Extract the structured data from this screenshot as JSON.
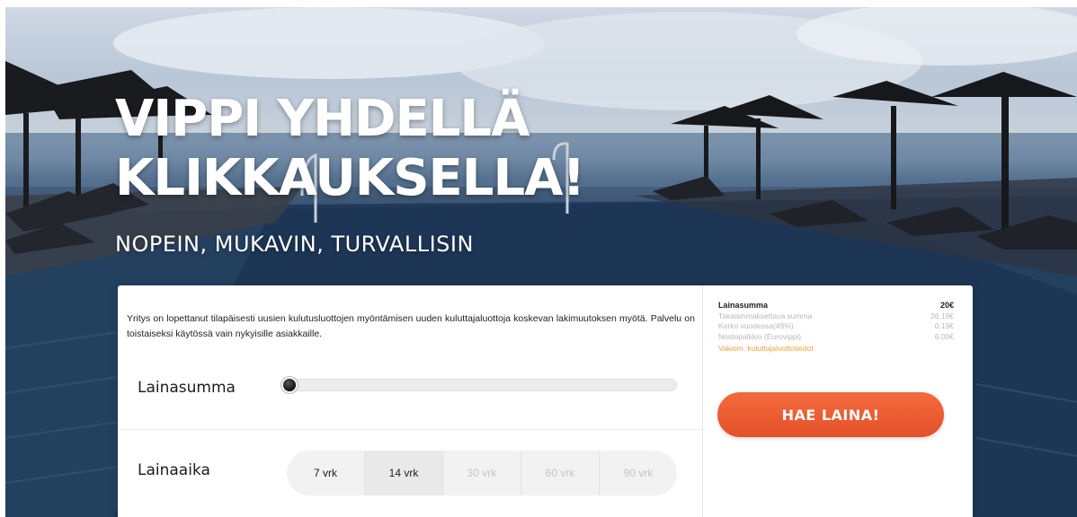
{
  "hero": {
    "title_line1": "VIPPI YHDELLÄ",
    "title_line2": "KLIKKAUKSELLA!",
    "subtitle": "NOPEIN, MUKAVIN, TURVALLISIN"
  },
  "card": {
    "notice": "Yritys on lopettanut tilapäisesti uusien kulutusluottojen myöntämisen uuden kuluttajaluottoja koskevan lakimuutoksen myötä. Palvelu on toistaiseksi käytössä vain nykyisille asiakkaille.",
    "amount_label": "Lainasumma",
    "amount_fraction": 0.0,
    "period_label": "Lainaaika",
    "period_options": [
      {
        "label": "7 vrk",
        "enabled": true,
        "selected": false
      },
      {
        "label": "14 vrk",
        "enabled": true,
        "selected": true
      },
      {
        "label": "30 vrk",
        "enabled": false,
        "selected": false
      },
      {
        "label": "60 vrk",
        "enabled": false,
        "selected": false
      },
      {
        "label": "90 vrk",
        "enabled": false,
        "selected": false
      }
    ]
  },
  "summary": {
    "rows": [
      {
        "label": "Lainasumma",
        "value": "20€"
      },
      {
        "label": "Takaisinmaksettava summa",
        "value": "26.19€"
      },
      {
        "label": "Korko vuodessa(49%)",
        "value": "0.19€"
      },
      {
        "label": "Nostopalkkio (Eurovippi)",
        "value": "6.00€"
      }
    ],
    "terms_link": "Vakiom. kuluttajaluottotiedot",
    "apply_button": "HAE LAINA!"
  },
  "colors": {
    "accent": "#e85a30",
    "link": "#f0a236"
  }
}
